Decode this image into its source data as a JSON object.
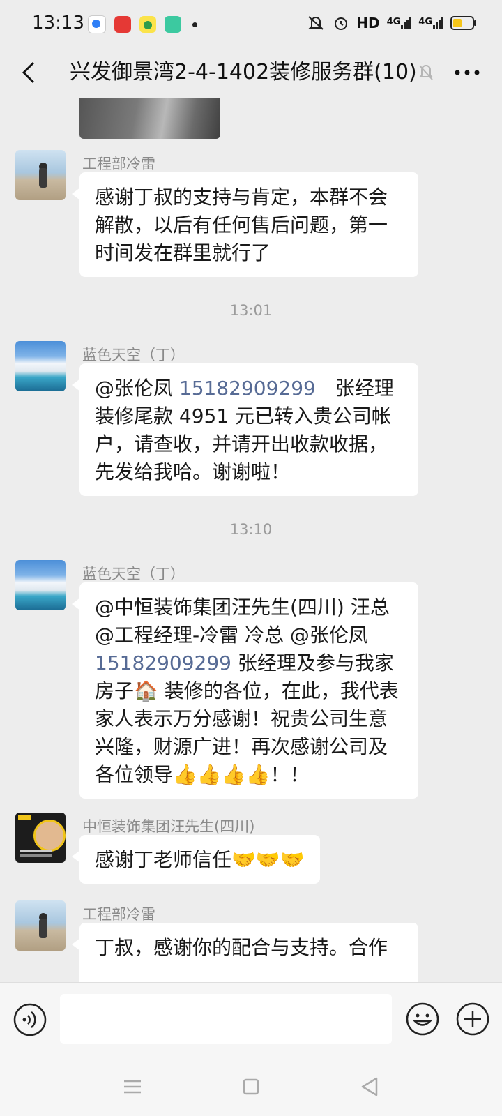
{
  "status_bar": {
    "time": "13:13",
    "hd_label": "HD",
    "signal1": "4G",
    "signal2": "4G",
    "battery_level": 0.45
  },
  "header": {
    "title": "兴发御景湾2-4-1402装修服务群(10)"
  },
  "messages": [
    {
      "sender": "工程部冷雷",
      "text": "感谢丁叔的支持与肯定，本群不会解散，以后有任何售后问题，第一时间发在群里就行了"
    },
    {
      "time": "13:01"
    },
    {
      "sender": "蓝色天空（丁）",
      "parts": [
        "@张伦凤 ",
        "15182909299",
        "　张经理 装修尾款 4951 元已转入贵公司帐户，请查收，并请开出收款收据，先发给我哈。谢谢啦！"
      ]
    },
    {
      "time": "13:10"
    },
    {
      "sender": "蓝色天空（丁）",
      "parts": [
        "@中恒装饰集团汪先生(四川)  汪总  @工程经理-冷雷  冷总  @张伦凤 ",
        "15182909299",
        " 张经理及参与我家房子🏠 装修的各位，在此，我代表家人表示万分感谢！祝贵公司生意兴隆，财源广进！再次感谢公司及各位领导👍👍👍👍！！"
      ]
    },
    {
      "sender": "中恒装饰集团汪先生(四川)",
      "text": "感谢丁老师信任🤝🤝🤝"
    },
    {
      "sender": "工程部冷雷",
      "text": "丁叔，感谢你的配合与支持。合作"
    }
  ],
  "input": {
    "value": ""
  },
  "colors": {
    "background": "#ededed",
    "bubble": "#ffffff",
    "link": "#576b95"
  },
  "icons": [
    "back-icon",
    "mute-icon",
    "more-icon",
    "voice-icon",
    "emoji-icon",
    "plus-icon",
    "nav-menu-icon",
    "nav-home-icon",
    "nav-back-icon"
  ]
}
